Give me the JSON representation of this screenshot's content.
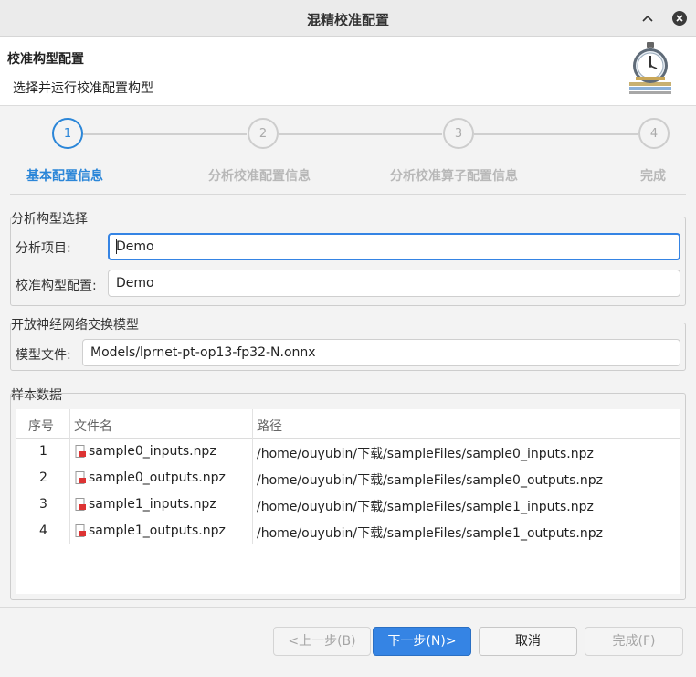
{
  "window": {
    "title": "混精校准配置"
  },
  "header": {
    "title": "校准构型配置",
    "subtitle": "选择并运行校准配置构型"
  },
  "steps": [
    {
      "number": "1",
      "label": "基本配置信息",
      "active": true
    },
    {
      "number": "2",
      "label": "分析校准配置信息",
      "active": false
    },
    {
      "number": "3",
      "label": "分析校准算子配置信息",
      "active": false
    },
    {
      "number": "4",
      "label": "完成",
      "active": false
    }
  ],
  "analysis_group": {
    "title": "分析构型选择",
    "project_label": "分析项目:",
    "project_value": "Demo",
    "config_label": "校准构型配置:",
    "config_value": "Demo"
  },
  "model_group": {
    "title": "开放神经网络交换模型",
    "file_label": "模型文件:",
    "file_value": "Models/lprnet-pt-op13-fp32-N.onnx"
  },
  "samples_group": {
    "title": "样本数据",
    "columns": [
      "序号",
      "文件名",
      "路径"
    ],
    "rows": [
      {
        "index": "1",
        "name": "sample0_inputs.npz",
        "path": "/home/ouyubin/下载/sampleFiles/sample0_inputs.npz"
      },
      {
        "index": "2",
        "name": "sample0_outputs.npz",
        "path": "/home/ouyubin/下载/sampleFiles/sample0_outputs.npz"
      },
      {
        "index": "3",
        "name": "sample1_inputs.npz",
        "path": "/home/ouyubin/下载/sampleFiles/sample1_inputs.npz"
      },
      {
        "index": "4",
        "name": "sample1_outputs.npz",
        "path": "/home/ouyubin/下载/sampleFiles/sample1_outputs.npz"
      }
    ]
  },
  "buttons": {
    "back": "<上一步(B)",
    "next": "下一步(N)>",
    "cancel": "取消",
    "finish": "完成(F)"
  },
  "colors": {
    "accent": "#2b86d8",
    "primary_button": "#3584e4"
  }
}
